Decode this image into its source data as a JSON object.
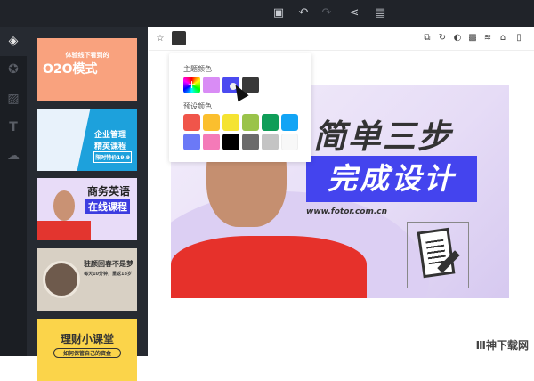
{
  "topbar": {
    "icons": [
      "add-image-icon",
      "undo-icon",
      "redo-icon",
      "share-icon",
      "save-icon"
    ]
  },
  "rail": {
    "icons": [
      "layers-icon",
      "star-icon",
      "texture-icon",
      "text-icon",
      "upload-icon"
    ]
  },
  "templates": [
    {
      "title": "O2O模式",
      "subtitle": "体验线下看到的",
      "bg": "#f9a27e",
      "color": "#ffffff"
    },
    {
      "title": "企业管理 精英课程",
      "subtitle": "限时特价19.9",
      "bg": "#1da1dc",
      "color": "#ffffff"
    },
    {
      "title": "商务英语",
      "subtitle": "在线课程",
      "bg": "#e8dcf8",
      "color": "#222222"
    },
    {
      "title": "驻颜回春不是梦",
      "subtitle": "每天10分钟，重返18岁",
      "bg": "#d8d0c4",
      "color": "#333333"
    },
    {
      "title": "理财小课堂",
      "subtitle": "如何保管自己的资金",
      "bg": "#fbd44a",
      "color": "#333333"
    }
  ],
  "canvas_toolbar": {
    "icons": [
      "duplicate-icon",
      "rotate-icon",
      "mask-icon",
      "transparency-icon",
      "layer-icon",
      "lock-icon",
      "delete-icon"
    ],
    "current_color": "#333333"
  },
  "color_popup": {
    "theme_label": "主题颜色",
    "preset_label": "预设颜色",
    "theme_colors": [
      "rainbow",
      "#d98cf5",
      "#4b4af0",
      "#383838"
    ],
    "preset_colors": [
      "#f0554a",
      "#fbbf2e",
      "#f5e332",
      "#9ac34a",
      "#0f9d58",
      "#12a4f5",
      "#6b79f7",
      "#f47ab8",
      "#000000",
      "#6b6b6b",
      "#c4c4c4",
      "#f8f8f8"
    ]
  },
  "banner": {
    "headline": "简单三步",
    "subheadline": "完成设计",
    "url": "www.fotor.com.cn",
    "accent": "#4444ee"
  },
  "watermark": "Ⅲ神下载网"
}
